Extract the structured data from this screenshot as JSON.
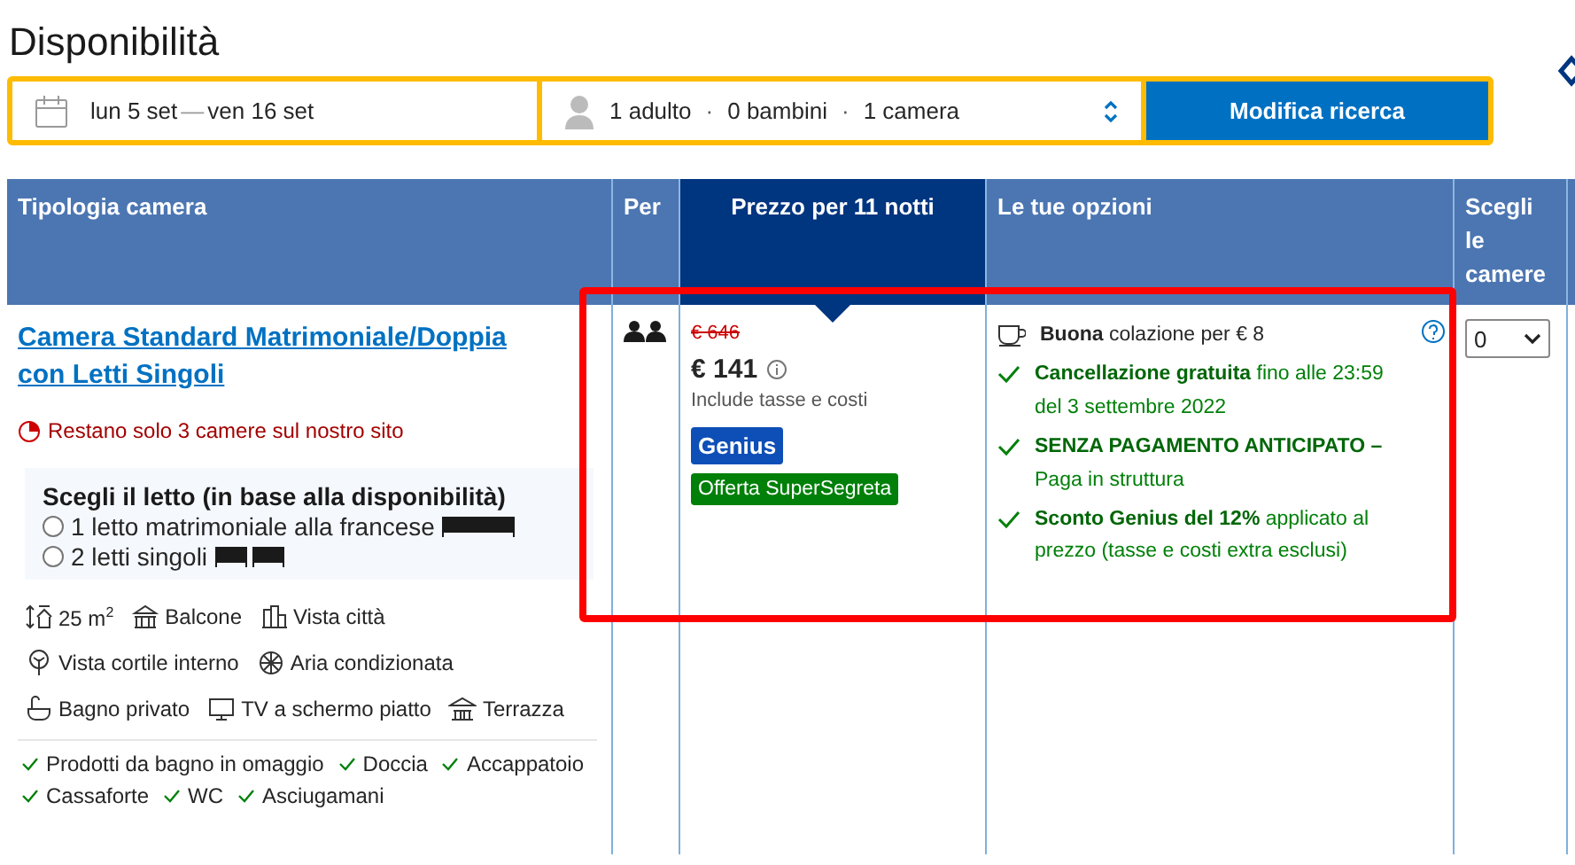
{
  "heading": "Disponibilità",
  "search": {
    "dates": [
      "lun 5 set",
      "ven 16 set"
    ],
    "date_separator": "—",
    "guests": [
      "1 adulto",
      "0 bambini",
      "1 camera"
    ],
    "guest_separator": "·",
    "button": "Modifica ricerca"
  },
  "table": {
    "columns": [
      {
        "label": "Tipologia camera",
        "highlighted": false
      },
      {
        "label": "Per",
        "highlighted": false
      },
      {
        "label": "Prezzo per 11 notti",
        "highlighted": true
      },
      {
        "label": "Le tue opzioni",
        "highlighted": false
      },
      {
        "label": "Scegli le camere",
        "highlighted": false
      }
    ],
    "room": {
      "name": "Camera Standard Matrimoniale/Doppia con Letti Singoli",
      "urgency": "Restano solo 3 camere sul nostro sito",
      "bed_prompt": "Scegli il letto (in base alla disponibilità)",
      "beds": [
        {
          "label": "1 letto matrimoniale alla francese",
          "kind": "double",
          "selected": false
        },
        {
          "label": "2 letti singoli",
          "kind": "twin",
          "selected": false
        }
      ],
      "features": [
        [
          {
            "label": "25 m$^{2}$",
            "kind": "size"
          },
          {
            "label": "Balcone",
            "kind": "balcony"
          },
          {
            "label": "Vista città",
            "kind": "city"
          }
        ],
        [
          {
            "label": "Vista cortile interno",
            "kind": "courtyard"
          },
          {
            "label": "Aria condizionata",
            "kind": "ac"
          }
        ],
        [
          {
            "label": "Bagno privato",
            "kind": "bathroom"
          },
          {
            "label": "TV a schermo piatto",
            "kind": "tv"
          },
          {
            "label": "Terrazza",
            "kind": "terrace"
          }
        ]
      ],
      "amenities": [
        "Prodotti da bagno in omaggio",
        "Doccia",
        "Accappatoio",
        "Cassaforte",
        "WC",
        "Asciugamani"
      ]
    },
    "price": {
      "original": "€ 646",
      "current": "€ 141",
      "note": "Include tasse e costi",
      "badges": [
        {
          "label": "Genius",
          "kind": "genius"
        },
        {
          "label": "Offerta SuperSegreta",
          "kind": "deal"
        }
      ]
    },
    "options": [
      {
        "kind": "breakfast",
        "text": "**Buona** colazione per € 8"
      },
      {
        "kind": "check",
        "text": "**Cancellazione gratuita** fino alle 23:59 del 3 settembre 2022"
      },
      {
        "kind": "check",
        "text": "**SENZA PAGAMENTO ANTICIPATO –** Paga in struttura"
      },
      {
        "kind": "check",
        "text": "**Sconto Genius del 12%** applicato al prezzo (tasse e costi extra esclusi)"
      }
    ],
    "rooms_select": {
      "value": "0"
    }
  }
}
